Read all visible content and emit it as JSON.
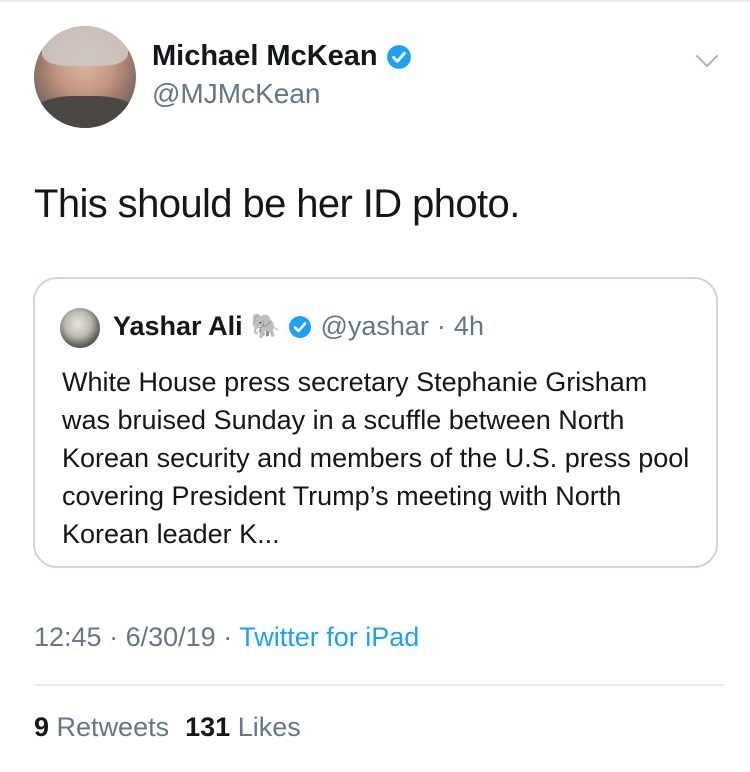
{
  "author": {
    "name": "Michael McKean",
    "handle": "@MJMcKean",
    "verified": true
  },
  "tweet": {
    "text": "This should be her ID photo."
  },
  "quoted_tweet": {
    "name": "Yashar Ali",
    "emoji": "🐘",
    "handle": "@yashar",
    "separator": "·",
    "time": "4h",
    "text": "White House press secretary Stephanie Grisham was bruised Sunday in a scuffle between North Korean security and members of the U.S. press pool covering President Trump’s meeting with North Korean leader K..."
  },
  "meta": {
    "time": "12:45",
    "separator": "·",
    "date": "6/30/19",
    "source": "Twitter for iPad"
  },
  "stats": {
    "retweets_count": "9",
    "retweets_label": "Retweets",
    "likes_count": "131",
    "likes_label": "Likes"
  },
  "colors": {
    "accent": "#1da1f2",
    "text": "#14171a",
    "secondary": "#657786",
    "border": "#ccd6dd"
  },
  "icons": {
    "verified": "verified-badge-icon",
    "menu": "chevron-down-icon"
  }
}
